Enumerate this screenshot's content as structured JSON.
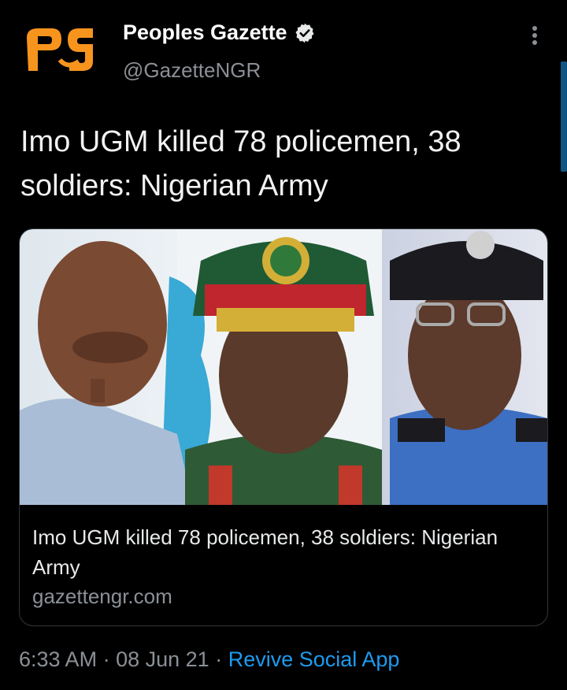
{
  "account": {
    "display_name": "Peoples Gazette",
    "handle": "@GazetteNGR",
    "avatar_icon": "pg-logo-icon",
    "avatar_color": "#f7941d",
    "verified_icon": "verified-badge-icon"
  },
  "tweet": {
    "text": "Imo UGM killed 78 policemen, 38 soldiers: Nigerian Army"
  },
  "link_card": {
    "title": "Imo UGM killed 78 policemen, 38 soldiers: Nigerian Army",
    "domain": "gazettengr.com",
    "image_icon": "news-photo-image"
  },
  "meta": {
    "time": "6:33 AM",
    "date": "08 Jun 21",
    "separator": "·",
    "app": "Revive Social App",
    "app_color": "#1d9bf0"
  },
  "menu_icon": "more-options-icon"
}
